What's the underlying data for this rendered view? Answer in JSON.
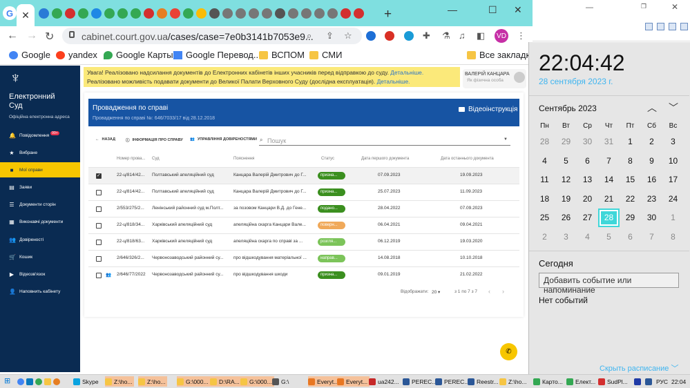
{
  "browser": {
    "app_letter": "G",
    "active_tab_close": "✕",
    "new_tab": "+",
    "url_host": "cabinet.court.gov.ua",
    "url_path": "/cases/case=7e0b3141b7053e9...",
    "profile": "VD",
    "favicons": [
      "#2a7ad6",
      "#34a853",
      "#d32f2f",
      "#34a853",
      "#1e88e5",
      "#34a853",
      "#34a853",
      "#34a853",
      "#d32f2f",
      "#e67e22",
      "#ea4335",
      "#34a853",
      "#fbbc05",
      "#555555",
      "#777777",
      "#777777",
      "#777777",
      "#777777",
      "#555555",
      "#777777",
      "#777777",
      "#777777",
      "#777777",
      "#d32f2f",
      "#d32f2f"
    ]
  },
  "bookmarks": {
    "items": [
      "Google",
      "yandex",
      "Google Карты",
      "Google Перевод...",
      "ВСПОМ",
      "СМИ"
    ],
    "all": "Все закладки"
  },
  "sidebar": {
    "brand": "Електронний Суд",
    "brand_sub": "Офіційна електронна адреса",
    "items": [
      {
        "label": "Повідомлення",
        "icon": "bell-icon",
        "glyph": "🔔",
        "badge": "99+"
      },
      {
        "label": "Вибране",
        "icon": "star-icon",
        "glyph": "★"
      },
      {
        "label": "Мої справи",
        "icon": "folder-icon",
        "glyph": "■"
      },
      {
        "label": "Заяви",
        "icon": "document-icon",
        "glyph": "▤"
      },
      {
        "label": "Документи сторін",
        "icon": "list-icon",
        "glyph": "☰"
      },
      {
        "label": "Виконавчі документи",
        "icon": "grid-icon",
        "glyph": "▦"
      },
      {
        "label": "Довіреності",
        "icon": "people-icon",
        "glyph": "👥"
      },
      {
        "label": "Кошик",
        "icon": "cart-icon",
        "glyph": "🛒"
      },
      {
        "label": "Відеозв'язок",
        "icon": "video-icon",
        "glyph": "▶"
      },
      {
        "label": "Наповнить кабінету",
        "icon": "person-icon",
        "glyph": "👤"
      }
    ]
  },
  "notice": {
    "line1": "Увага! Реалізовано надсилання документів до Електронних кабінетів інших учасників перед відправкою до суду.",
    "line1_link": "Детальніше.",
    "line2": "Реалізовано можливість подавати документи до Великої Палати Верховного Суду (дослідна експлуатація).",
    "line2_link": "Детальніше."
  },
  "user": {
    "name": "ВАЛЕРІЙ КАНЦАРА",
    "type": "Як фізична особа"
  },
  "case": {
    "title": "Провадження по справі",
    "subtitle": "Провадження по справі №: 646/7033/17 від 28.12.2018",
    "video": "Відеоінструкція"
  },
  "actions": {
    "back": "НАЗАД",
    "info": "ІНФОРМАЦІЯ ПРО СПРАВУ",
    "proxy": "УПРАВЛІННЯ ДОВІРЕНОСТЯМИ",
    "search_placeholder": "Пошук"
  },
  "table": {
    "headers": [
      "Номер прова...",
      "Суд",
      "Пояснення",
      "Статус",
      "Дата першого документа",
      "Дата останнього документа"
    ],
    "rows": [
      {
        "checked": true,
        "num": "22-ц/814/42...",
        "court": "Полтавський апеляційний суд",
        "desc": "Канцара Валерій Дмитрович до Г...",
        "status": "призна...",
        "status_color": "#3b8f1f",
        "first": "07.09.2023",
        "last": "19.09.2023"
      },
      {
        "checked": false,
        "num": "22-ц/814/42...",
        "court": "Полтавський апеляційний суд",
        "desc": "Канцара Валерій Дмитрович до Г...",
        "status": "призна...",
        "status_color": "#3b8f1f",
        "first": "25.07.2023",
        "last": "11.09.2023"
      },
      {
        "checked": false,
        "num": "2/553/275/2...",
        "court": "Ленінський районний суд м.Полт...",
        "desc": "за позовом Канцари В.Д. до Гене...",
        "status": "подано...",
        "status_color": "#3b8f1f",
        "first": "28.04.2022",
        "last": "07.09.2023"
      },
      {
        "checked": false,
        "num": "22-ц/818/34...",
        "court": "Харківський апеляційний суд",
        "desc": "апеляційна скарга Канцари Вале...",
        "status": "поверн...",
        "status_color": "#f0a95a",
        "first": "06.04.2021",
        "last": "09.04.2021"
      },
      {
        "checked": false,
        "num": "22-ц/818/63...",
        "court": "Харківський апеляційний суд",
        "desc": "апеляційна скарга по справі за ...",
        "status": "розгля...",
        "status_color": "#7cc45a",
        "first": "06.12.2019",
        "last": "19.03.2020"
      },
      {
        "checked": false,
        "num": "2/646/326/2...",
        "court": "Червонозаводський районний су...",
        "desc": "про відшкодування матеріальної ...",
        "status": "направ...",
        "status_color": "#7cc45a",
        "first": "14.08.2018",
        "last": "10.10.2018"
      },
      {
        "checked": false,
        "num": "2/646/77/2022",
        "court": "Червонозаводський районний су...",
        "desc": "про відшкодування шкоди",
        "status": "призна...",
        "status_color": "#3b8f1f",
        "first": "09.01.2019",
        "last": "21.02.2022"
      }
    ]
  },
  "pagination": {
    "label": "Відображати:",
    "per_page": "20",
    "range": "з 1 по 7 з 7"
  },
  "calendar": {
    "time": "22:04:42",
    "date": "28 сентября 2023 г.",
    "month": "Сентябрь 2023",
    "weekdays": [
      "Пн",
      "Вт",
      "Ср",
      "Чт",
      "Пт",
      "Сб",
      "Вс"
    ],
    "days": [
      "28",
      "29",
      "30",
      "31",
      "1",
      "2",
      "3",
      "4",
      "5",
      "6",
      "7",
      "8",
      "9",
      "10",
      "11",
      "12",
      "13",
      "14",
      "15",
      "16",
      "17",
      "18",
      "19",
      "20",
      "21",
      "22",
      "23",
      "24",
      "25",
      "26",
      "27",
      "28",
      "29",
      "30",
      "1",
      "2",
      "3",
      "4",
      "5",
      "6",
      "7",
      "8"
    ],
    "today_label": "Сегодня",
    "add_event": "Добавить событие или напоминание",
    "no_events": "Нет событий",
    "schedule": "Скрыть расписание"
  },
  "taskbar": {
    "items": [
      {
        "label": "Skype",
        "color": "#0aa3e0"
      },
      {
        "label": "Z:\\ho...",
        "color": "#f6c544"
      },
      {
        "label": "Z:\\ho...",
        "color": "#f6c544"
      },
      {
        "label": "G:\\000...",
        "color": "#f6c544"
      },
      {
        "label": "D:\\RA...",
        "color": "#f6c544"
      },
      {
        "label": "G:\\000...",
        "color": "#f6c544"
      },
      {
        "label": "G:\\",
        "color": "#555555"
      },
      {
        "label": "Everyt...",
        "color": "#e87722"
      },
      {
        "label": "Everyt...",
        "color": "#e87722"
      },
      {
        "label": "ua242...",
        "color": "#c62828"
      },
      {
        "label": "PERЕС...",
        "color": "#2b5797"
      },
      {
        "label": "PERЕС...",
        "color": "#2b5797"
      },
      {
        "label": "Reestr...",
        "color": "#2b5797"
      },
      {
        "label": "Z:\\ho...",
        "color": "#f6c544"
      },
      {
        "label": "Карто...",
        "color": "#34a853"
      },
      {
        "label": "Елект...",
        "color": "#34a853"
      },
      {
        "label": "SudPl...",
        "color": "#d32f2f"
      }
    ],
    "lang": "РУС",
    "clock": "22:04"
  }
}
